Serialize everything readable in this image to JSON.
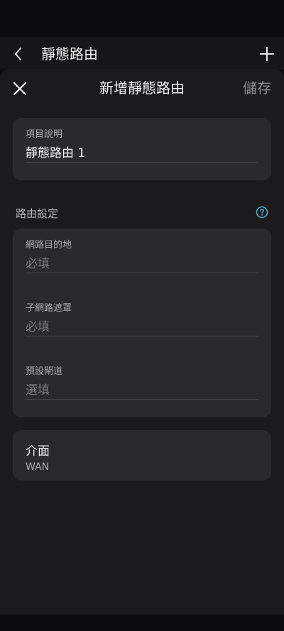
{
  "background_screen": {
    "title": "靜態路由",
    "back_icon": "chevron-left-icon",
    "add_icon": "plus-icon"
  },
  "sheet": {
    "title": "新增靜態路由",
    "close_icon": "close-icon",
    "save_label": "儲存"
  },
  "description_card": {
    "label": "項目說明",
    "value": "靜態路由 1"
  },
  "route_settings": {
    "section_title": "路由設定",
    "help_icon": "question-circle-icon",
    "fields": [
      {
        "label": "網路目的地",
        "value": "必填"
      },
      {
        "label": "子網路遮罩",
        "value": "必填"
      },
      {
        "label": "預設閘道",
        "value": "選填"
      }
    ]
  },
  "interface_card": {
    "title": "介面",
    "value": "WAN"
  },
  "colors": {
    "sheet_background": "#1b1b1d",
    "card_background": "#2a2a2d",
    "help_icon_accent": "#4fa9c9",
    "placeholder_text": "#7c7c80"
  }
}
